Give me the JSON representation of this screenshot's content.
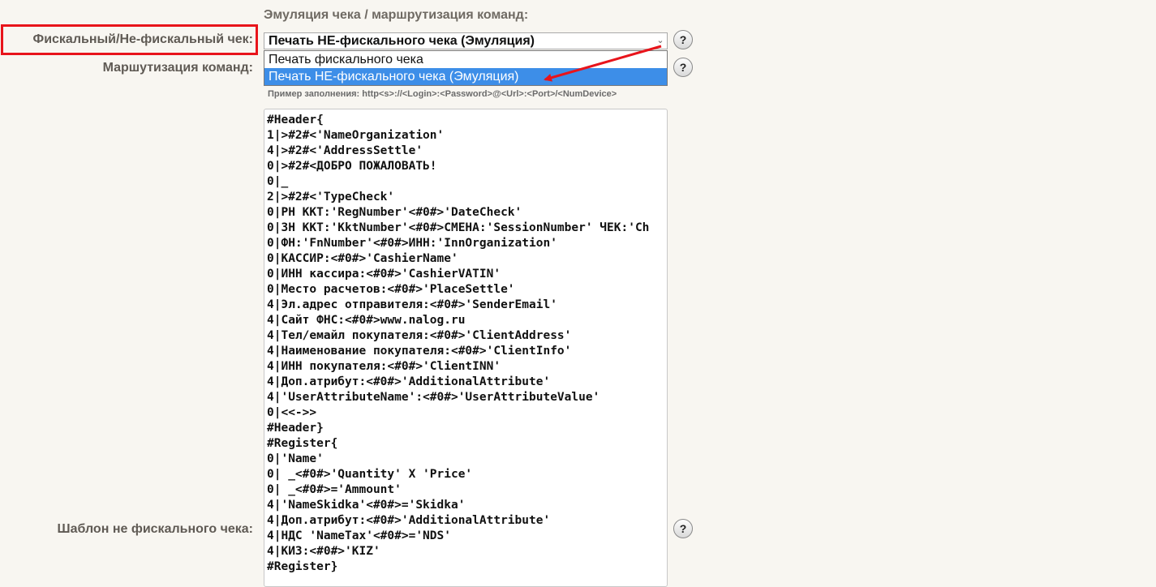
{
  "section_title": "Эмуляция чека / маршрутизация команд:",
  "fields": {
    "fiscal_label": "Фискальный/Не-фискальный чек:",
    "routing_label": "Маршутизация команд:",
    "template_label": "Шаблон не фискального чека:"
  },
  "fiscal_select": {
    "value": "Печать НЕ-фискального чека (Эмуляция)",
    "options": [
      "Печать фискального чека",
      "Печать НЕ-фискального чека (Эмуляция)"
    ],
    "selected_index": 1
  },
  "help_label": "?",
  "routing_hint": "Пример заполнения: http<s>://<Login>:<Password>@<Url>:<Port>/<NumDevice>",
  "template_lines": [
    "#Header{",
    "1|>#2#<'NameOrganization'",
    "4|>#2#<'AddressSettle'",
    "0|>#2#<ДОБРО ПОЖАЛОВАТЬ!",
    "0|_",
    "2|>#2#<'TypeCheck'",
    "0|РН ККТ:'RegNumber'<#0#>'DateCheck'",
    "0|ЗН ККТ:'KktNumber'<#0#>СМЕНА:'SessionNumber' ЧЕК:'Ch",
    "0|ФН:'FnNumber'<#0#>ИНН:'InnOrganization'",
    "0|КАССИР:<#0#>'CashierName'",
    "0|ИНН кассира:<#0#>'CashierVATIN'",
    "0|Место расчетов:<#0#>'PlaceSettle'",
    "4|Эл.адрес отправителя:<#0#>'SenderEmail'",
    "4|Сайт ФНС:<#0#>www.nalog.ru",
    "4|Тел/емайл покупателя:<#0#>'ClientAddress'",
    "4|Наименование покупателя:<#0#>'ClientInfo'",
    "4|ИНН покупателя:<#0#>'ClientINN'",
    "4|Доп.атрибут:<#0#>'AdditionalAttribute'",
    "4|'UserAttributeName':<#0#>'UserAttributeValue'",
    "0|<<->>",
    "#Header}",
    "#Register{",
    "0|'Name'",
    "0| _<#0#>'Quantity' X 'Price'",
    "0| _<#0#>='Ammount'",
    "4|'NameSkidka'<#0#>='Skidka'",
    "4|Доп.атрибут:<#0#>'AdditionalAttribute'",
    "4|НДС 'NameTax'<#0#>='NDS'",
    "4|КИЗ:<#0#>'KIZ'",
    "#Register}"
  ],
  "colors": {
    "background": "#f8f6f1",
    "highlight": "#e8141b",
    "selection": "#3d8ee8"
  }
}
